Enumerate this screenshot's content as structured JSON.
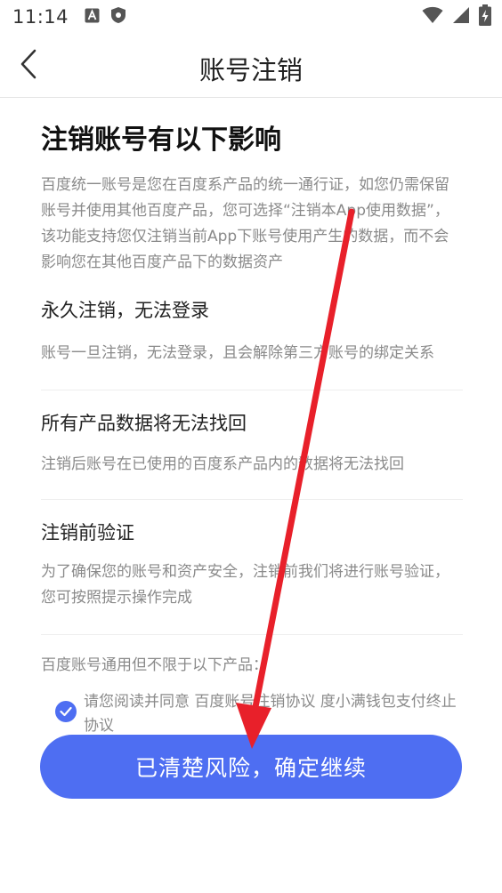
{
  "status_bar": {
    "time": "11:14",
    "icons": [
      "a-notification-icon",
      "shield-icon",
      "wifi-icon",
      "signal-icon",
      "battery-charging-icon"
    ]
  },
  "header": {
    "title": "账号注销",
    "back_icon": "chevron-left-icon"
  },
  "content": {
    "heading": "注销账号有以下影响",
    "intro": "百度统一账号是您在百度系产品的统一通行证，如您仍需保留账号并使用其他百度产品，您可选择“注销本App使用数据”，该功能支持您仅注销当前App下账号使用产生的数据，而不会影响您在其他百度产品下的数据资产",
    "sections": [
      {
        "title": "永久注销，无法登录",
        "desc": "账号一旦注销，无法登录，且会解除第三方账号的绑定关系"
      },
      {
        "title": "所有产品数据将无法找回",
        "desc": "注销后账号在已使用的百度系产品内的数据将无法找回"
      },
      {
        "title": "注销前验证",
        "desc": "为了确保您的账号和资产安全，注销前我们将进行账号验证，您可按照提示操作完成"
      }
    ],
    "products_line": "百度账号通用但不限于以下产品："
  },
  "agreement": {
    "checked": true,
    "prefix": "请您阅读并同意 ",
    "link1": "百度账号注销协议",
    "separator": " ",
    "link2": "度小满钱包支付终止协议"
  },
  "confirm_button": {
    "label": "已清楚风险，确定继续"
  },
  "colors": {
    "accent": "#4e6ef2",
    "arrow": "#e8202a",
    "muted_text": "#8a8a8a"
  }
}
